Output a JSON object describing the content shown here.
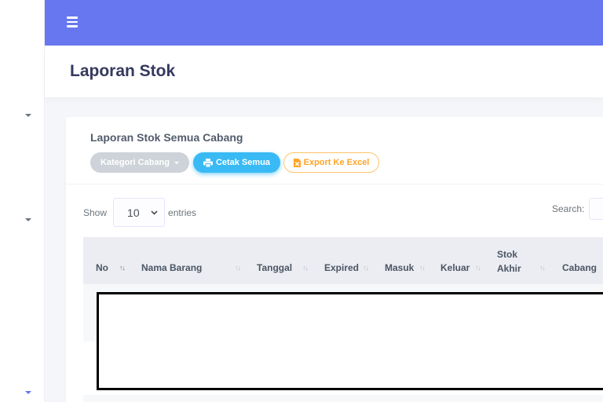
{
  "page": {
    "title": "Laporan Stok"
  },
  "navbar": {
    "menu_icon": "hamburger-icon",
    "color": "#6777ef"
  },
  "sidebar": {
    "icons": [
      "chevron-down-icon",
      "chevron-down-icon",
      "chevron-down-icon"
    ]
  },
  "card": {
    "title": "Laporan Stok Semua Cabang",
    "buttons": {
      "kategori": "Kategori Cabang",
      "cetak": "Cetak Semua",
      "excel": "Export Ke Excel"
    },
    "colors": {
      "cetak": "#3abaf4",
      "excel": "#ffa426",
      "kategori": "#cdd3d8"
    }
  },
  "table": {
    "show_label": "Show",
    "entries_value": "10",
    "entries_label": "entries",
    "search_label": "Search:",
    "columns": [
      "No",
      "Nama Barang",
      "Tanggal",
      "Expired",
      "Masuk",
      "Keluar",
      "Stok Akhir",
      "Cabang"
    ],
    "stok_akhir_line1": "Stok",
    "stok_akhir_line2": "Akhir"
  }
}
